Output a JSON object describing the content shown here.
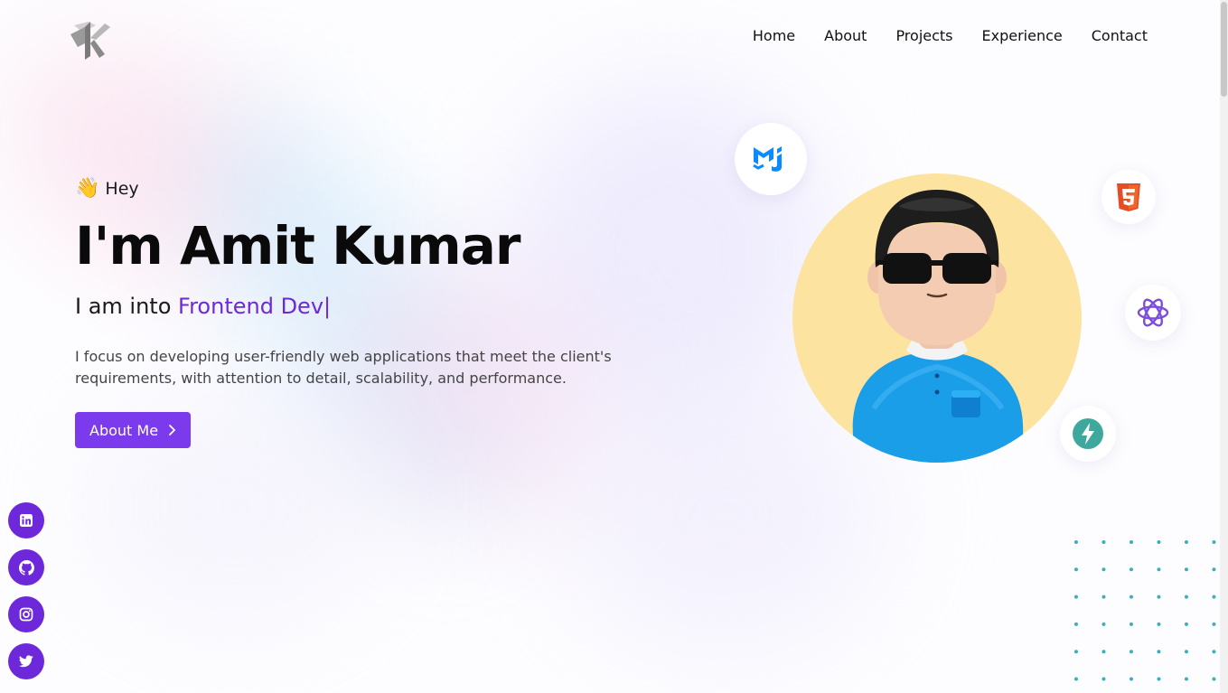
{
  "nav": {
    "logo_alt": "AK",
    "links": [
      "Home",
      "About",
      "Projects",
      "Experience",
      "Contact"
    ]
  },
  "hero": {
    "wave_emoji": "👋",
    "greeting": "Hey",
    "title": "I'm Amit Kumar",
    "role_prefix": "I am into ",
    "role_highlight": "Frontend Dev",
    "cursor": "|",
    "description": "I focus on developing user-friendly web applications that meet the client's requirements, with attention to detail, scalability, and performance.",
    "button_label": "About Me"
  },
  "tech_icons": [
    "material-ui-icon",
    "html5-icon",
    "react-icon",
    "bolt-icon"
  ],
  "social": [
    "linkedin-icon",
    "github-icon",
    "instagram-icon",
    "twitter-icon"
  ],
  "colors": {
    "accent": "#7c3aed",
    "accent_dark": "#6d28d9",
    "avatar_bg": "#fde3a0",
    "html5": "#e44d26",
    "mui": "#007fff",
    "react_purple": "#7c4ddb",
    "bolt": "#3fa89d"
  }
}
